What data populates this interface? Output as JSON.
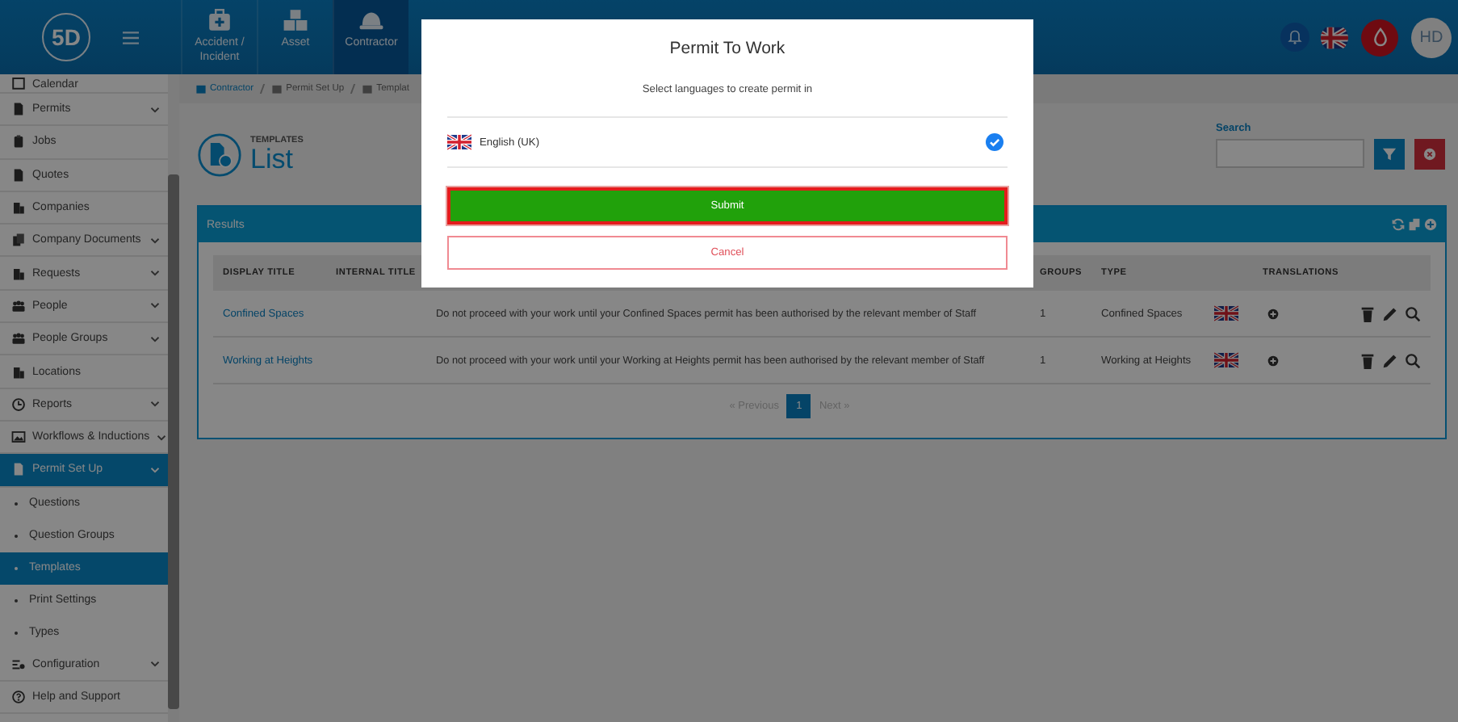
{
  "header": {
    "logo": "5D",
    "nav_tiles": [
      {
        "label": "Accident / Incident",
        "selected": false
      },
      {
        "label": "Asset",
        "selected": false
      },
      {
        "label": "Contractor",
        "selected": true
      }
    ],
    "avatar": "HD"
  },
  "sidebar": {
    "items": [
      {
        "label": "Calendar",
        "expandable": false,
        "selected": false
      },
      {
        "label": "Permits",
        "expandable": true,
        "selected": false
      },
      {
        "label": "Jobs",
        "expandable": false,
        "selected": false
      },
      {
        "label": "Quotes",
        "expandable": false,
        "selected": false
      },
      {
        "label": "Companies",
        "expandable": false,
        "selected": false
      },
      {
        "label": "Company Documents",
        "expandable": true,
        "selected": false
      },
      {
        "label": "Requests",
        "expandable": true,
        "selected": false
      },
      {
        "label": "People",
        "expandable": true,
        "selected": false
      },
      {
        "label": "People Groups",
        "expandable": true,
        "selected": false
      },
      {
        "label": "Locations",
        "expandable": false,
        "selected": false
      },
      {
        "label": "Reports",
        "expandable": true,
        "selected": false
      },
      {
        "label": "Workflows & Inductions",
        "expandable": true,
        "selected": false
      },
      {
        "label": "Permit Set Up",
        "expandable": true,
        "selected": true,
        "children": [
          {
            "label": "Questions",
            "selected": false
          },
          {
            "label": "Question Groups",
            "selected": false
          },
          {
            "label": "Templates",
            "selected": true
          },
          {
            "label": "Print Settings",
            "selected": false
          },
          {
            "label": "Types",
            "selected": false
          }
        ]
      },
      {
        "label": "Configuration",
        "expandable": true,
        "selected": false
      },
      {
        "label": "Help and Support",
        "expandable": false,
        "selected": false
      }
    ]
  },
  "breadcrumb": [
    "Contractor",
    "Permit Set Up",
    "Templat"
  ],
  "page_header": {
    "overline": "TEMPLATES",
    "title": "List"
  },
  "search": {
    "label": "Search"
  },
  "results": {
    "title": "Results",
    "columns": [
      "DISPLAY TITLE",
      "INTERNAL TITLE",
      "GROUPS",
      "TYPE",
      "TRANSLATIONS"
    ],
    "rows": [
      {
        "display_title": "Confined Spaces",
        "description": "Do not proceed with your work until your Confined Spaces permit has been authorised by the relevant member of Staff",
        "groups": "1",
        "type": "Confined Spaces"
      },
      {
        "display_title": "Working at Heights",
        "description": "Do not proceed with your work until your Working at Heights permit has been authorised by the relevant member of Staff",
        "groups": "1",
        "type": "Working at Heights"
      }
    ],
    "pagination": {
      "previous": "« Previous",
      "pages": [
        {
          "label": "1",
          "selected": true
        }
      ],
      "next": "Next »"
    }
  },
  "modal": {
    "title": "Permit To Work",
    "subtitle": "Select languages to create permit in",
    "languages": [
      {
        "label": "English (UK)",
        "selected": true
      }
    ],
    "submit": "Submit",
    "cancel": "Cancel"
  }
}
